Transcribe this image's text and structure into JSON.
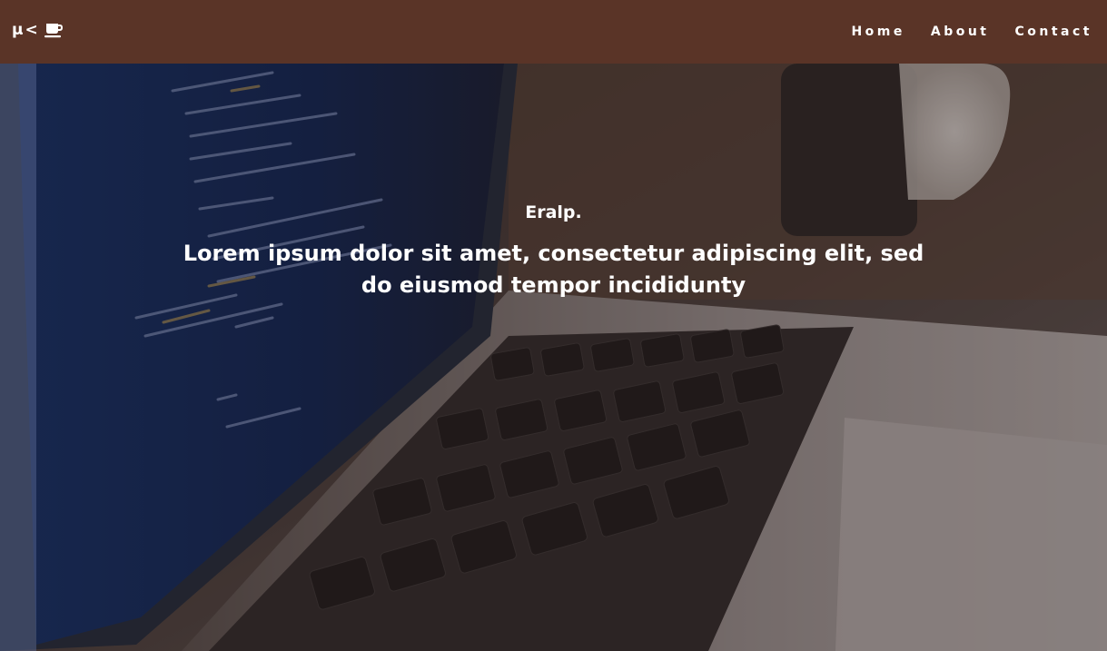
{
  "brand": {
    "text": "μ<",
    "icon": "coffee-cup-icon"
  },
  "nav": {
    "items": [
      {
        "label": "Home"
      },
      {
        "label": "About"
      },
      {
        "label": "Contact"
      }
    ]
  },
  "hero": {
    "name": "Eralp.",
    "tagline": "Lorem ipsum dolor sit amet, consectetur adipiscing elit, sed do eiusmod tempor incididunty",
    "background": "laptop-with-code-photo"
  },
  "colors": {
    "navbar": "#5a3427",
    "text": "#ffffff"
  }
}
